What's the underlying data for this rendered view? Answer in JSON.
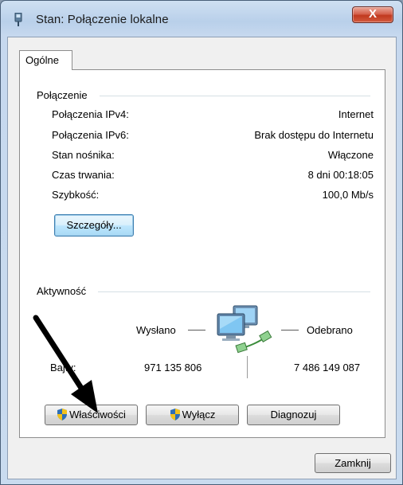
{
  "window": {
    "title": "Stan: Połączenie lokalne",
    "close_glyph": "X"
  },
  "tabs": [
    {
      "label": "Ogólne",
      "selected": true
    }
  ],
  "connection": {
    "title": "Połączenie",
    "rows": [
      {
        "label": "Połączenia IPv4:",
        "value": "Internet"
      },
      {
        "label": "Połączenia IPv6:",
        "value": "Brak dostępu do Internetu"
      },
      {
        "label": "Stan nośnika:",
        "value": "Włączone"
      },
      {
        "label": "Czas trwania:",
        "value": "8 dni 00:18:05"
      },
      {
        "label": "Szybkość:",
        "value": "100,0 Mb/s"
      }
    ],
    "details_button": "Szczegóły..."
  },
  "activity": {
    "title": "Aktywność",
    "sent_label": "Wysłano",
    "received_label": "Odebrano",
    "bytes_label": "Bajty:",
    "sent_bytes": "971 135 806",
    "received_bytes": "7 486 149 087",
    "icon": "network-computers-icon"
  },
  "buttons": {
    "properties": "Właściwości",
    "disable": "Wyłącz",
    "diagnose": "Diagnozuj",
    "close": "Zamknij"
  },
  "colors": {
    "accent_blue": "#3c7fb1",
    "close_red": "#c0391f"
  }
}
